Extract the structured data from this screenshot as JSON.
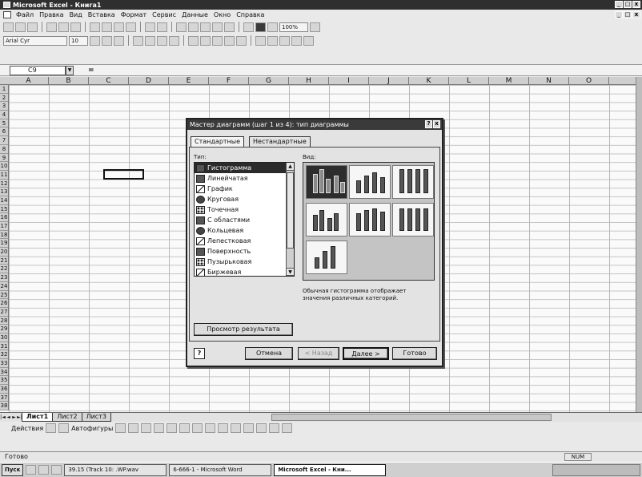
{
  "window": {
    "title": "Microsoft Excel - Книга1",
    "controls": [
      "_",
      "□",
      "x"
    ]
  },
  "menu": {
    "items": [
      "Файл",
      "Правка",
      "Вид",
      "Вставка",
      "Формат",
      "Сервис",
      "Данные",
      "Окно",
      "Справка"
    ]
  },
  "toolbar": {
    "zoom": "100%",
    "font_name": "Arial Cyr",
    "font_size": "10"
  },
  "formula_bar": {
    "name_box": "C9",
    "equals": "="
  },
  "sheet": {
    "columns": [
      "A",
      "B",
      "C",
      "D",
      "E",
      "F",
      "G",
      "H",
      "I",
      "J",
      "K",
      "L",
      "M",
      "N",
      "O"
    ],
    "rows": [
      "1",
      "2",
      "3",
      "4",
      "5",
      "6",
      "7",
      "8",
      "9",
      "10",
      "11",
      "12",
      "13",
      "14",
      "15",
      "16",
      "17",
      "18",
      "19",
      "20",
      "21",
      "22",
      "23",
      "24",
      "25",
      "26",
      "27",
      "28",
      "29",
      "30",
      "31",
      "32",
      "33",
      "34",
      "35",
      "36",
      "37",
      "38"
    ],
    "tabs": [
      "Лист1",
      "Лист2",
      "Лист3"
    ],
    "active_tab": "Лист1",
    "nav_buttons": [
      "|◄",
      "◄",
      "►",
      "►|"
    ]
  },
  "drawing_bar": {
    "actions_label": "Действия",
    "autoshapes_label": "Автофигуры"
  },
  "status": {
    "text": "Готово",
    "num": "NUM"
  },
  "taskbar": {
    "start": "Пуск",
    "tasks": [
      {
        "label": "39.15 (Track 10: .WP.wav",
        "active": false
      },
      {
        "label": "6-666-1 - Microsoft Word",
        "active": false
      },
      {
        "label": "Microsoft Excel - Кни...",
        "active": true
      }
    ]
  },
  "dialog": {
    "title": "Мастер диаграмм (шаг 1 из 4): тип диаграммы",
    "help_mark": "?",
    "close_mark": "x",
    "tabs": [
      "Стандартные",
      "Нестандартные"
    ],
    "type_label": "Тип:",
    "view_label": "Вид:",
    "types": [
      {
        "label": "Гистограмма",
        "icon": "bar-chart-icon",
        "selected": true
      },
      {
        "label": "Линейчатая",
        "icon": "horizontal-bar-icon",
        "selected": false
      },
      {
        "label": "График",
        "icon": "line-chart-icon",
        "selected": false
      },
      {
        "label": "Круговая",
        "icon": "pie-chart-icon",
        "selected": false
      },
      {
        "label": "Точечная",
        "icon": "scatter-chart-icon",
        "selected": false
      },
      {
        "label": "С областями",
        "icon": "area-chart-icon",
        "selected": false
      },
      {
        "label": "Кольцевая",
        "icon": "doughnut-chart-icon",
        "selected": false
      },
      {
        "label": "Лепестковая",
        "icon": "radar-chart-icon",
        "selected": false
      },
      {
        "label": "Поверхность",
        "icon": "surface-chart-icon",
        "selected": false
      },
      {
        "label": "Пузырьковая",
        "icon": "bubble-chart-icon",
        "selected": false
      },
      {
        "label": "Биржевая",
        "icon": "stock-chart-icon",
        "selected": false
      }
    ],
    "description": "Обычная гистограмма отображает значения различных категорий.",
    "preview_button": "Просмотр результата",
    "buttons": {
      "cancel": "Отмена",
      "back": "< Назад",
      "next": "Далее >",
      "finish": "Готово"
    }
  }
}
